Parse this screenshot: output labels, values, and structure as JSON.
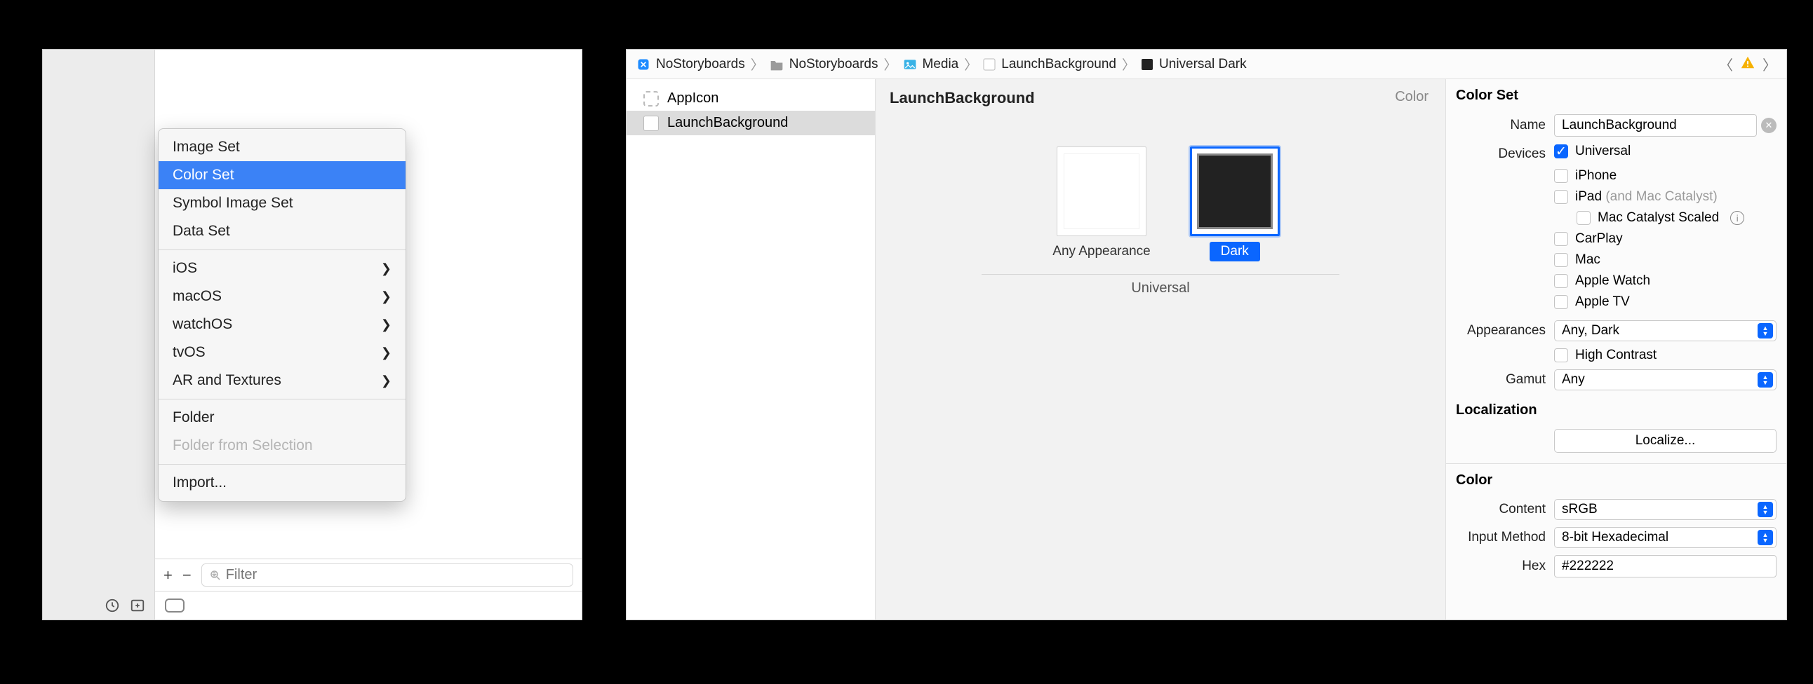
{
  "context_menu": {
    "image_set": "Image Set",
    "color_set": "Color Set",
    "symbol_image_set": "Symbol Image Set",
    "data_set": "Data Set",
    "ios": "iOS",
    "macos": "macOS",
    "watchos": "watchOS",
    "tvos": "tvOS",
    "ar_textures": "AR and Textures",
    "folder": "Folder",
    "folder_from_selection": "Folder from Selection",
    "import": "Import..."
  },
  "filter_placeholder": "Filter",
  "breadcrumb": {
    "proj1": "NoStoryboards",
    "proj2": "NoStoryboards",
    "media": "Media",
    "asset": "LaunchBackground",
    "variant": "Universal Dark"
  },
  "asset_list": {
    "appicon": "AppIcon",
    "launchbg": "LaunchBackground"
  },
  "canvas": {
    "title": "LaunchBackground",
    "type_label": "Color",
    "any_appearance": "Any Appearance",
    "dark": "Dark",
    "universal": "Universal"
  },
  "inspector": {
    "section_title": "Color Set",
    "name_label": "Name",
    "name_value": "LaunchBackground",
    "devices_label": "Devices",
    "dev_universal": "Universal",
    "dev_iphone": "iPhone",
    "dev_ipad": "iPad",
    "dev_ipad_hint": "(and Mac Catalyst)",
    "dev_mac_catalyst_scaled": "Mac Catalyst Scaled",
    "dev_carplay": "CarPlay",
    "dev_mac": "Mac",
    "dev_watch": "Apple Watch",
    "dev_tv": "Apple TV",
    "appearances_label": "Appearances",
    "appearances_value": "Any, Dark",
    "high_contrast": "High Contrast",
    "gamut_label": "Gamut",
    "gamut_value": "Any",
    "localization_label": "Localization",
    "localize_btn": "Localize...",
    "color_section": "Color",
    "content_label": "Content",
    "content_value": "sRGB",
    "input_method_label": "Input Method",
    "input_method_value": "8-bit Hexadecimal",
    "hex_label": "Hex",
    "hex_value": "#222222"
  }
}
